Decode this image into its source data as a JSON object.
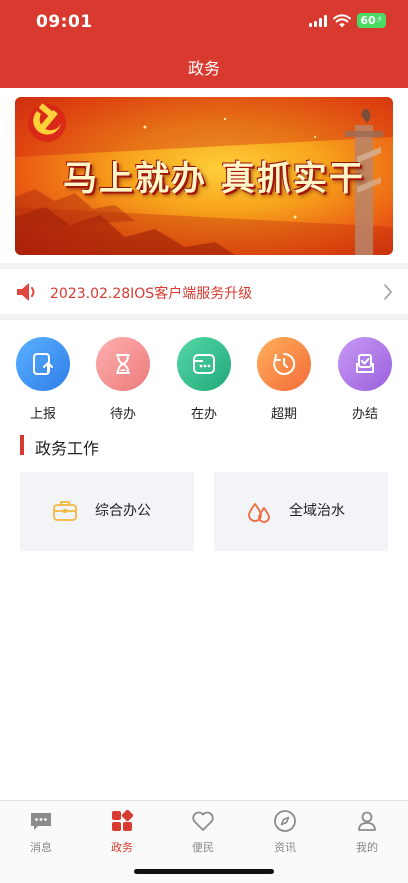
{
  "status_bar": {
    "time": "09:01",
    "battery": "60"
  },
  "header": {
    "title": "政务"
  },
  "banner": {
    "slogan": "马上就办 真抓实干"
  },
  "notice": {
    "text": "2023.02.28IOS客户端服务升级"
  },
  "quick_actions": [
    {
      "label": "上报",
      "icon": "report-upload-icon",
      "color": "#2f8ef0"
    },
    {
      "label": "待办",
      "icon": "hourglass-icon",
      "color": "#f08a8a"
    },
    {
      "label": "在办",
      "icon": "in-progress-icon",
      "color": "#2ebd8f"
    },
    {
      "label": "超期",
      "icon": "overdue-clock-icon",
      "color": "#f5803e"
    },
    {
      "label": "办结",
      "icon": "completed-check-icon",
      "color": "#a66be0"
    }
  ],
  "section": {
    "title": "政务工作"
  },
  "cards": [
    {
      "label": "综合办公",
      "icon": "briefcase-icon"
    },
    {
      "label": "全域治水",
      "icon": "water-drops-icon"
    }
  ],
  "tabbar": [
    {
      "label": "消息",
      "icon": "message-icon"
    },
    {
      "label": "政务",
      "icon": "apps-grid-icon",
      "active": true
    },
    {
      "label": "便民",
      "icon": "heart-icon"
    },
    {
      "label": "资讯",
      "icon": "compass-icon"
    },
    {
      "label": "我的",
      "icon": "user-icon"
    }
  ],
  "colors": {
    "primary": "#d93a30",
    "card_bg": "#f3f4f8"
  }
}
